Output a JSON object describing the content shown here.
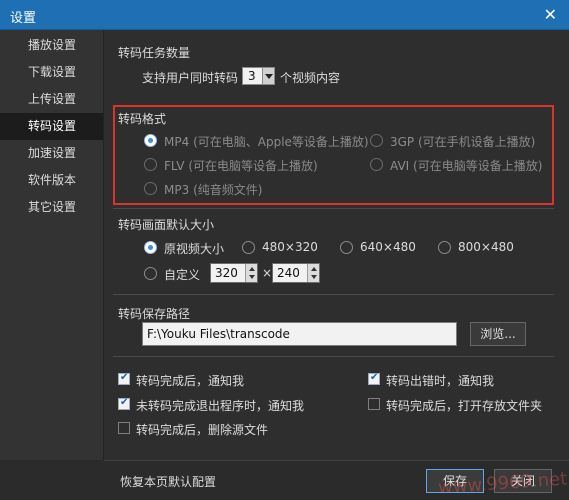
{
  "window": {
    "title": "设置",
    "close_glyph": "✕"
  },
  "sidebar": {
    "items": [
      {
        "label": "播放设置",
        "active": false
      },
      {
        "label": "下载设置",
        "active": false
      },
      {
        "label": "上传设置",
        "active": false
      },
      {
        "label": "转码设置",
        "active": true
      },
      {
        "label": "加速设置",
        "active": false
      },
      {
        "label": "软件版本",
        "active": false
      },
      {
        "label": "其它设置",
        "active": false
      }
    ]
  },
  "task_count": {
    "heading": "转码任务数量",
    "prefix": "支持用户同时转码",
    "value": "3",
    "suffix": "个视频内容"
  },
  "format": {
    "heading": "转码格式",
    "options": [
      {
        "name": "MP4",
        "note": "(可在电脑、Apple等设备上播放)",
        "selected": true
      },
      {
        "name": "3GP",
        "note": "(可在手机设备上播放)",
        "selected": false
      },
      {
        "name": "FLV",
        "note": "(可在电脑等设备上播放)",
        "selected": false
      },
      {
        "name": "AVI",
        "note": "(可在电脑等设备上播放)",
        "selected": false
      },
      {
        "name": "MP3",
        "note": "(纯音频文件)",
        "selected": false
      }
    ]
  },
  "resolution": {
    "heading": "转码画面默认大小",
    "options": [
      {
        "label": "原视频大小",
        "selected": true
      },
      {
        "label": "480×320",
        "selected": false
      },
      {
        "label": "640×480",
        "selected": false
      },
      {
        "label": "800×480",
        "selected": false
      }
    ],
    "custom_label": "自定义",
    "custom_width": "320",
    "times": "×",
    "custom_height": "240"
  },
  "save_path": {
    "heading": "转码保存路径",
    "value": "F:\\Youku Files\\transcode",
    "browse_label": "浏览..."
  },
  "notifications": {
    "items": [
      {
        "label": "转码完成后，通知我",
        "checked": true
      },
      {
        "label": "转码出错时，通知我",
        "checked": true
      },
      {
        "label": "未转码完成退出程序时，通知我",
        "checked": true
      },
      {
        "label": "转码完成后，打开存放文件夹",
        "checked": false
      },
      {
        "label": "转码完成后，删除源文件",
        "checked": false
      }
    ]
  },
  "footer": {
    "restore_label": "恢复本页默认配置",
    "save_label": "保存",
    "close_label": "关闭"
  },
  "watermark": "www.9969.net",
  "colors": {
    "titlebar": "#1f6fb4",
    "highlight_box": "#d9342b",
    "radio_selected": "#3a8fe0"
  }
}
